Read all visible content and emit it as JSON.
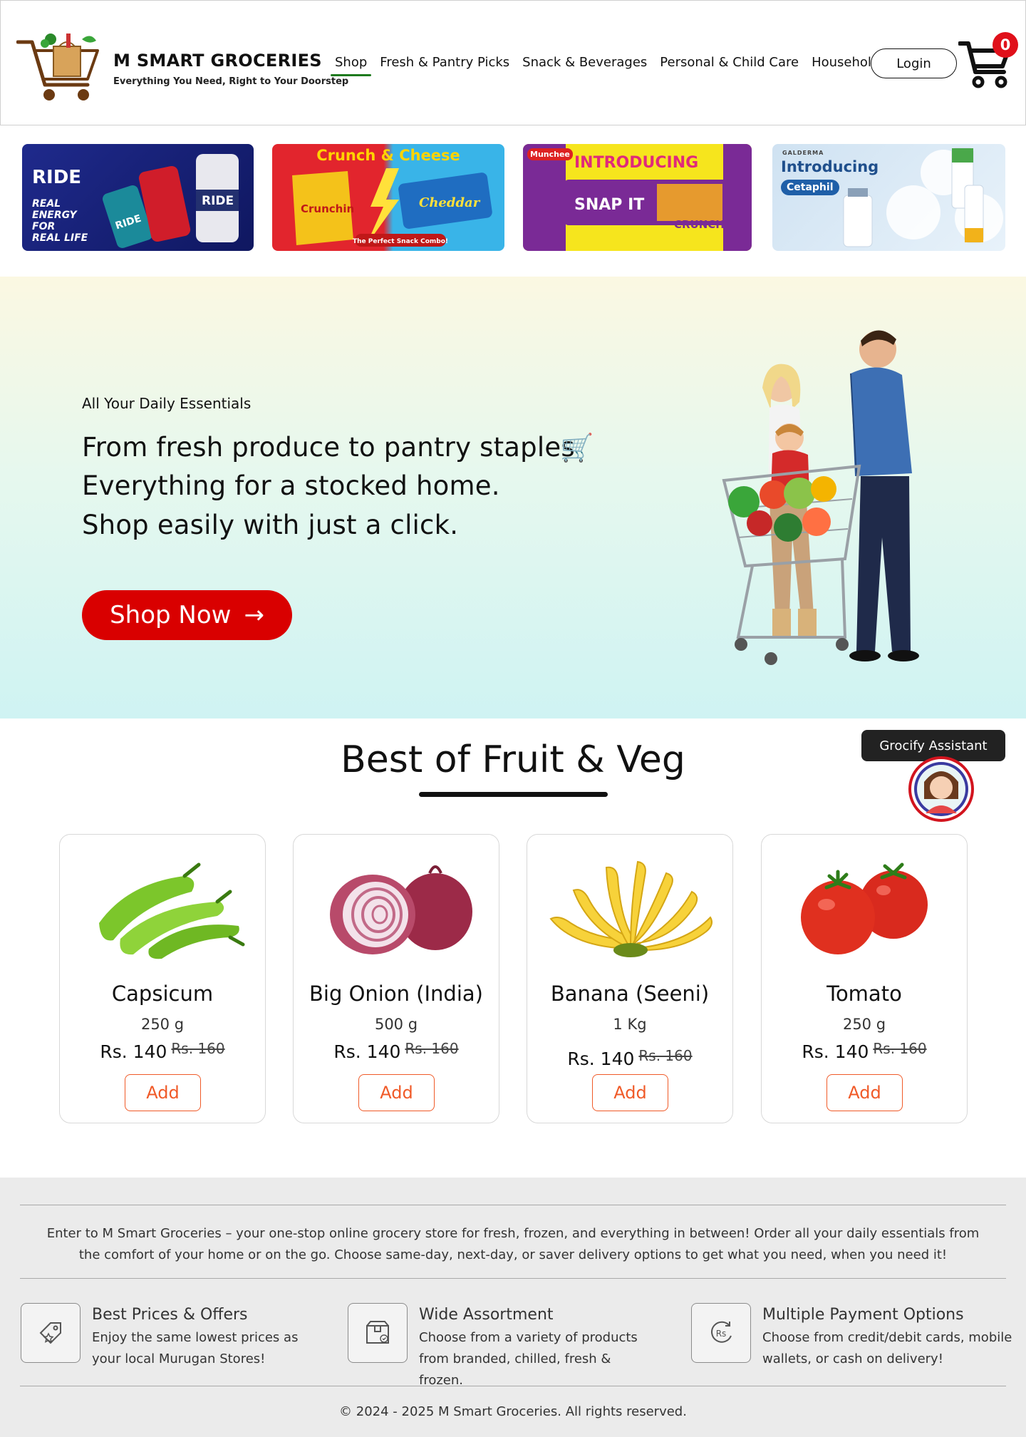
{
  "header": {
    "brand_title": "M SMART GROCERIES",
    "brand_tagline": "Everything You Need, Right to Your Doorstep",
    "nav": [
      {
        "label": "Shop",
        "active": true
      },
      {
        "label": "Fresh & Pantry Picks"
      },
      {
        "label": "Snack & Beverages"
      },
      {
        "label": "Personal & Child Care"
      },
      {
        "label": "Household"
      }
    ],
    "login_label": "Login",
    "cart_count": "0"
  },
  "banners": [
    {
      "name": "ride-energy-drink",
      "texts": [
        "RIDE",
        "REAL",
        "ENERGY",
        "FOR",
        "REAL LIFE",
        "RIDE",
        "RIDE"
      ]
    },
    {
      "name": "crunch-and-cheese",
      "texts": [
        "Crunch & Cheese",
        "Crunchin",
        "Cheddar",
        "The Perfect Snack Combo!"
      ]
    },
    {
      "name": "munchee-snapit",
      "texts": [
        "Munchee",
        "INTRODUCING",
        "SNAP IT",
        "CRUNCHY"
      ]
    },
    {
      "name": "cetaphil",
      "texts": [
        "GALDERMA",
        "Introducing",
        "Cetaphil"
      ]
    }
  ],
  "hero": {
    "kicker": "All Your Daily Essentials",
    "line1": "From fresh produce to pantry staples",
    "line2": "Everything for a stocked home.",
    "line3": "Shop easily with just a click.",
    "cart_emoji": "🛒",
    "cta_label": "Shop Now",
    "cta_arrow": "→"
  },
  "section": {
    "title": "Best of Fruit & Veg"
  },
  "assistant": {
    "label": "Grocify Assistant"
  },
  "products": [
    {
      "name": "Capsicum",
      "size": "250 g",
      "price": "Rs. 140",
      "old_price": "Rs. 160",
      "add_label": "Add",
      "image": "capsicum"
    },
    {
      "name": "Big Onion (India)",
      "size": "500 g",
      "price": "Rs. 140",
      "old_price": "Rs. 160",
      "add_label": "Add",
      "image": "onion"
    },
    {
      "name": "Banana (Seeni)",
      "size": "1 Kg",
      "price": "Rs. 140",
      "old_price": "Rs. 160",
      "add_label": "Add",
      "image": "banana"
    },
    {
      "name": "Tomato",
      "size": "250 g",
      "price": "Rs. 140",
      "old_price": "Rs. 160",
      "add_label": "Add",
      "image": "tomato"
    }
  ],
  "footer": {
    "intro": "Enter to M Smart Groceries – your one-stop online grocery store for fresh, frozen, and everything in between! Order all your daily essentials from the comfort of your home or on the go. Choose same-day, next-day, or saver delivery options to get what you need, when you need it!",
    "features": [
      {
        "title": "Best Prices & Offers",
        "desc": "Enjoy the same lowest prices as your local Murugan Stores!",
        "icon": "price-tag-icon"
      },
      {
        "title": "Wide Assortment",
        "desc": "Choose from a variety of products from branded, chilled, fresh & frozen.",
        "icon": "box-icon"
      },
      {
        "title": "Multiple Payment Options",
        "desc": "Choose from credit/debit cards, mobile wallets, or cash on delivery!",
        "icon": "rupee-icon",
        "icon_text": "Rs"
      }
    ],
    "copyright": "© 2024 - 2025 M Smart Groceries. All rights reserved."
  },
  "colors": {
    "accent_red": "#d90000",
    "add_orange": "#f05a28",
    "nav_active": "#1e7a1e",
    "badge_red": "#e0101a"
  }
}
